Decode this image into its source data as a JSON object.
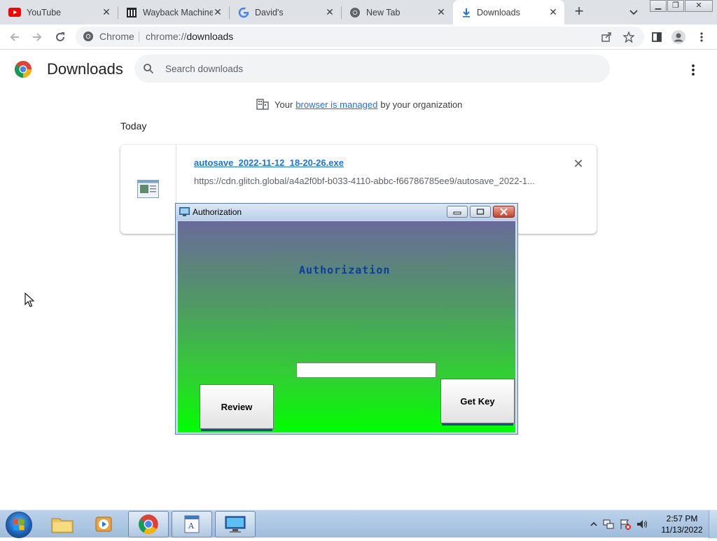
{
  "browser": {
    "tabs": [
      {
        "title": "YouTube",
        "icon": "youtube-icon"
      },
      {
        "title": "Wayback Machine",
        "icon": "wayback-icon"
      },
      {
        "title": "David's",
        "icon": "google-icon"
      },
      {
        "title": "New Tab",
        "icon": "chrome-icon"
      },
      {
        "title": "Downloads",
        "icon": "download-icon"
      }
    ],
    "active_tab": "Downloads",
    "omnibox": {
      "chip": "Chrome",
      "url_scheme": "chrome://",
      "url_path": "downloads"
    }
  },
  "downloads_page": {
    "title": "Downloads",
    "search_placeholder": "Search downloads",
    "managed_prefix": "Your",
    "managed_link": "browser is managed",
    "managed_suffix": "by your organization",
    "date_header": "Today",
    "items": [
      {
        "filename": "autosave_2022-11-12_18-20-26.exe",
        "url": "https://cdn.glitch.global/a4a2f0bf-b033-4110-abbc-f66786785ee9/autosave_2022-1..."
      }
    ]
  },
  "auth_dialog": {
    "window_title": "Authorization",
    "heading": "Authorization",
    "key_value": "",
    "review_label": "Review",
    "getkey_label": "Get Key"
  },
  "taskbar": {
    "apps": [
      "explorer-icon",
      "media-player-icon",
      "chrome-icon",
      "wordpad-icon",
      "remote-desktop-icon"
    ],
    "time": "2:57 PM",
    "date": "11/13/2022"
  },
  "colors": {
    "accent_blue": "#1a73e8",
    "auth_heading": "#0c3ca0",
    "auth_gradient_top": "#6a6a9a",
    "auth_gradient_bottom": "#00ff00"
  }
}
